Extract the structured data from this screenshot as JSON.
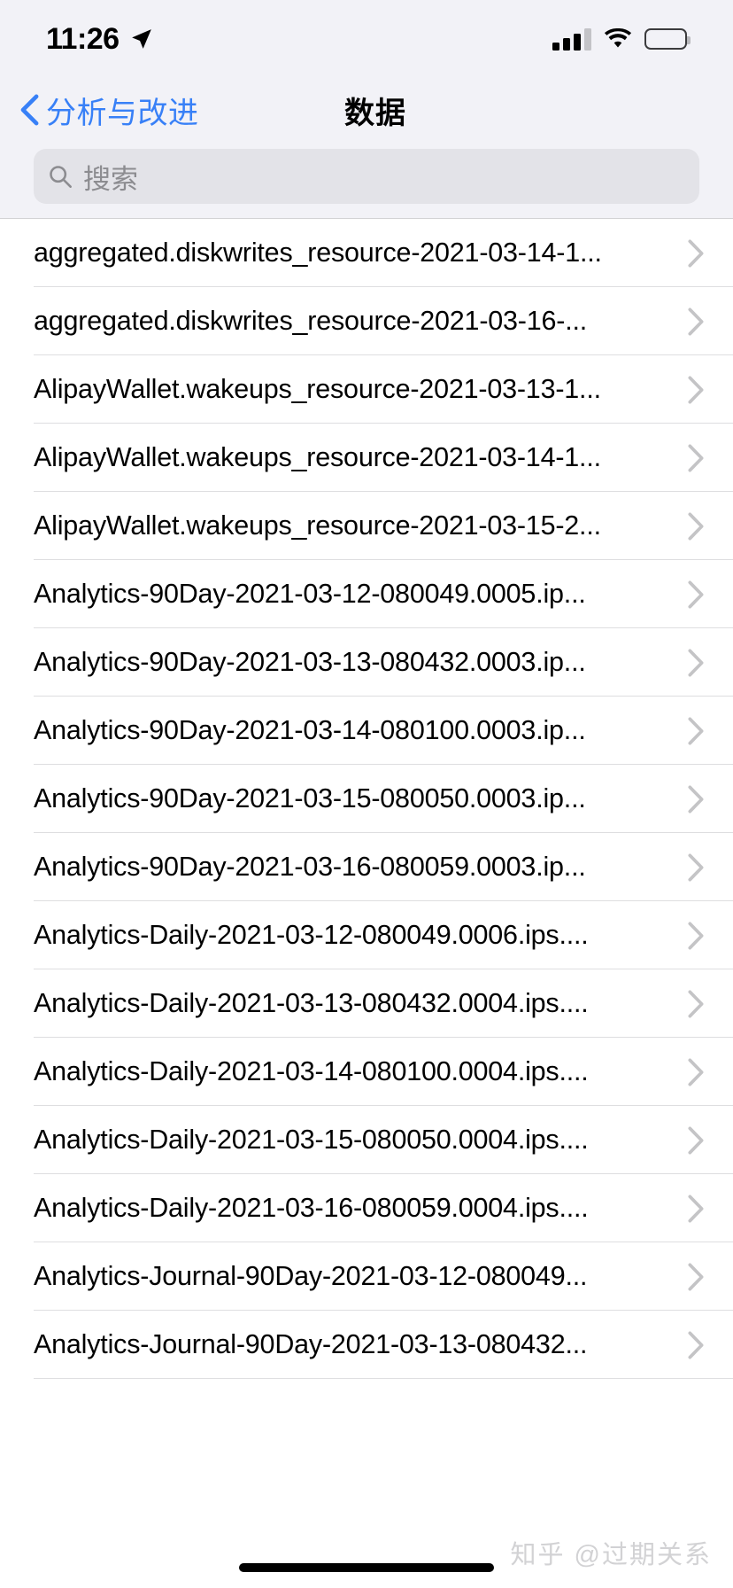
{
  "status_bar": {
    "time": "11:26",
    "location_icon": "location-arrow-icon",
    "signal_icon": "cellular-signal-icon",
    "signal_bars_filled": 3,
    "signal_bars_total": 4,
    "wifi_icon": "wifi-icon",
    "battery_icon": "battery-full-icon"
  },
  "nav": {
    "back_label": "分析与改进",
    "back_icon": "chevron-left-icon",
    "title": "数据"
  },
  "search": {
    "placeholder": "搜索",
    "value": "",
    "icon": "search-icon"
  },
  "colors": {
    "accent": "#3880f7",
    "chrome_background": "#f2f2f7",
    "list_background": "#ffffff",
    "separator": "#dedee0",
    "search_field": "#e3e3e8",
    "placeholder_text": "#8c8c90",
    "watermark": "#d2d2d4"
  },
  "list": {
    "disclosure_icon": "chevron-right-icon",
    "items": [
      {
        "label": "aggregated.diskwrites_resource-2021-03-14-1..."
      },
      {
        "label": "aggregated.diskwrites_resource-2021-03-16-..."
      },
      {
        "label": "AlipayWallet.wakeups_resource-2021-03-13-1..."
      },
      {
        "label": "AlipayWallet.wakeups_resource-2021-03-14-1..."
      },
      {
        "label": "AlipayWallet.wakeups_resource-2021-03-15-2..."
      },
      {
        "label": "Analytics-90Day-2021-03-12-080049.0005.ip..."
      },
      {
        "label": "Analytics-90Day-2021-03-13-080432.0003.ip..."
      },
      {
        "label": "Analytics-90Day-2021-03-14-080100.0003.ip..."
      },
      {
        "label": "Analytics-90Day-2021-03-15-080050.0003.ip..."
      },
      {
        "label": "Analytics-90Day-2021-03-16-080059.0003.ip..."
      },
      {
        "label": "Analytics-Daily-2021-03-12-080049.0006.ips...."
      },
      {
        "label": "Analytics-Daily-2021-03-13-080432.0004.ips...."
      },
      {
        "label": "Analytics-Daily-2021-03-14-080100.0004.ips...."
      },
      {
        "label": "Analytics-Daily-2021-03-15-080050.0004.ips...."
      },
      {
        "label": "Analytics-Daily-2021-03-16-080059.0004.ips...."
      },
      {
        "label": "Analytics-Journal-90Day-2021-03-12-080049..."
      },
      {
        "label": "Analytics-Journal-90Day-2021-03-13-080432..."
      }
    ]
  },
  "watermark": {
    "text": "知乎 @过期关系"
  }
}
